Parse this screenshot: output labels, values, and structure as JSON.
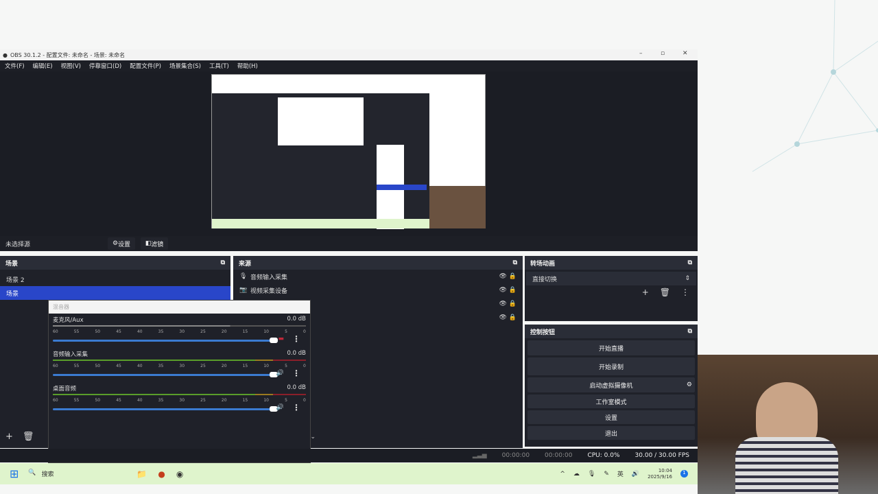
{
  "window": {
    "title": "OBS 30.1.2 - 配置文件: 未命名 - 场景: 未命名"
  },
  "menu": [
    "文件(F)",
    "编辑(E)",
    "视图(V)",
    "停靠窗口(D)",
    "配置文件(P)",
    "场景集合(S)",
    "工具(T)",
    "帮助(H)"
  ],
  "source_toolbar": {
    "no_source": "未选择源",
    "settings": "设置",
    "filters": "滤镜"
  },
  "scenes": {
    "title": "场景",
    "items": [
      "场景 2",
      "场景"
    ],
    "selected": 1
  },
  "sources": {
    "title": "来源",
    "items": [
      {
        "label": "音频输入采集",
        "icon": "microphone-icon"
      },
      {
        "label": "视频采集设备",
        "icon": "camera-icon"
      }
    ]
  },
  "mixer": {
    "title": "混音器",
    "ticks": [
      "60",
      "55",
      "50",
      "45",
      "40",
      "35",
      "30",
      "25",
      "20",
      "15",
      "10",
      "5",
      "0"
    ],
    "channels": [
      {
        "name": "麦克风/Aux",
        "db": "0.0 dB",
        "muted": true
      },
      {
        "name": "音频输入采集",
        "db": "0.0 dB",
        "muted": false
      },
      {
        "name": "桌面音频",
        "db": "0.0 dB",
        "muted": false
      }
    ]
  },
  "transitions": {
    "title": "转场动画",
    "selected": "直接切换"
  },
  "controls": {
    "title": "控制按钮",
    "buttons": [
      "开始直播",
      "开始录制",
      "启动虚拟摄像机",
      "工作室模式",
      "设置",
      "退出"
    ],
    "active": 1
  },
  "status": {
    "stream_time": "00:00:00",
    "record_time": "00:00:00",
    "cpu": "CPU: 0.0%",
    "fps": "30.00 / 30.00 FPS"
  },
  "taskbar": {
    "search": "搜索",
    "time": "10:04",
    "date": "2025/9/16",
    "notification_count": "1"
  },
  "colors": {
    "accent": "#2946c9",
    "panel": "#1f2129",
    "taskbar": "#dff4cc"
  }
}
